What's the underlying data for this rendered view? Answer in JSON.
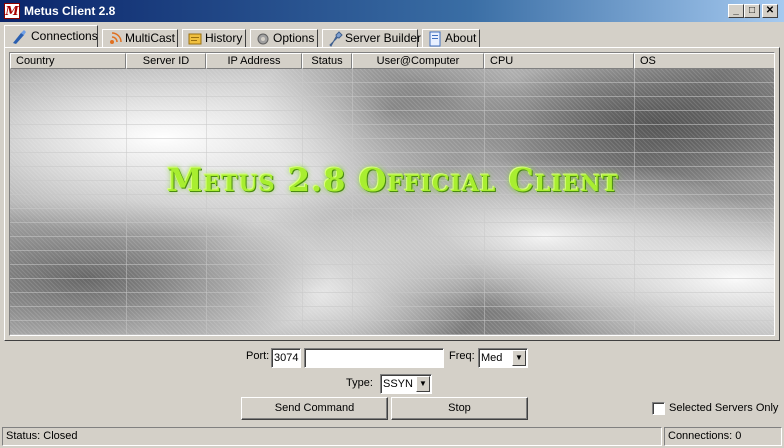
{
  "window": {
    "title": "Metus Client 2.8",
    "icon_letter": "M",
    "minimize_glyph": "_",
    "maximize_glyph": "□",
    "close_glyph": "✕"
  },
  "tabs": [
    {
      "label": "Connections",
      "icon": "connections-icon",
      "active": true
    },
    {
      "label": "MultiCast",
      "icon": "broadcast-icon",
      "active": false
    },
    {
      "label": "History",
      "icon": "history-icon",
      "active": false
    },
    {
      "label": "Options",
      "icon": "gear-icon",
      "active": false
    },
    {
      "label": "Server Builder",
      "icon": "wrench-icon",
      "active": false
    },
    {
      "label": "About",
      "icon": "document-icon",
      "active": false
    }
  ],
  "table": {
    "columns": [
      "Country",
      "Server ID",
      "IP Address",
      "Status",
      "User@Computer",
      "CPU",
      "OS"
    ],
    "rows": [],
    "watermark": "Metus 2.8 Official Client",
    "watermark_color": "#a8ee30"
  },
  "controls": {
    "port_label": "Port:",
    "port_value": "3074",
    "target_value": "",
    "freq_label": "Freq:",
    "freq_value": "Med",
    "type_label": "Type:",
    "type_value": "SSYN",
    "send_button": "Send Command",
    "stop_button": "Stop",
    "selected_only_label": "Selected Servers Only",
    "selected_only_checked": false
  },
  "statusbar": {
    "status": "Status: Closed",
    "connections": "Connections: 0"
  },
  "colors": {
    "face": "#d4d0c8",
    "titlebar_start": "#0a246a",
    "titlebar_end": "#a6caf0"
  }
}
